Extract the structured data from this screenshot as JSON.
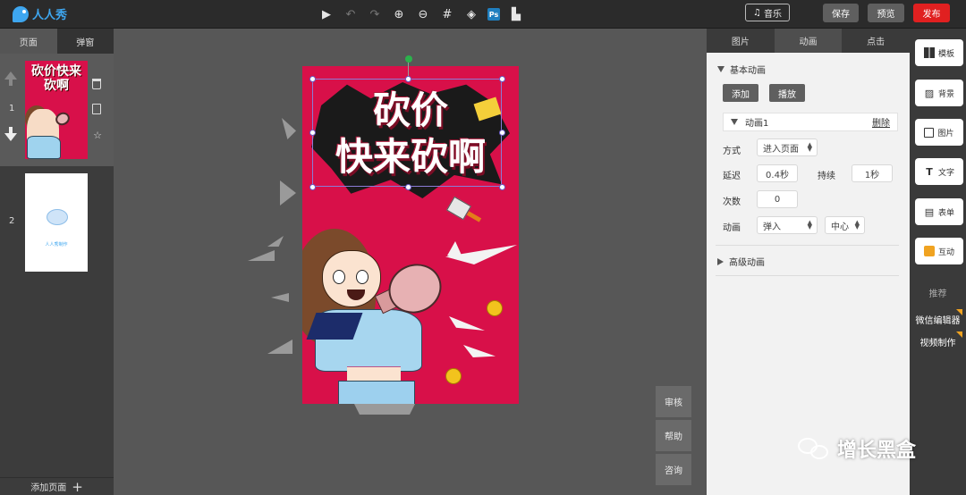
{
  "app": {
    "logo_text": "人人秀",
    "brand_color": "#3ea6ef"
  },
  "toolbar": {
    "icons": [
      "play-icon",
      "undo-icon",
      "redo-icon",
      "zoom-in-icon",
      "zoom-out-icon",
      "grid-icon",
      "layers-icon",
      "ps-icon",
      "align-icon"
    ],
    "ps_label": "Ps",
    "music_label": "音乐",
    "save_label": "保存",
    "preview_label": "预览",
    "publish_label": "发布",
    "publish_color": "#e02020"
  },
  "left_panel": {
    "tabs": [
      {
        "label": "页面"
      },
      {
        "label": "弹窗"
      }
    ],
    "pages": [
      {
        "number": "1",
        "thumb_title": "砍价快来砍啊"
      },
      {
        "number": "2",
        "thumb_caption": "人人秀制作"
      }
    ],
    "add_page_label": "添加页面"
  },
  "canvas": {
    "poster_title_line1": "砍价",
    "poster_title_line2": "快来砍啊",
    "poster_bg_color": "#d81049",
    "side_buttons": [
      {
        "label": "审核"
      },
      {
        "label": "帮助"
      },
      {
        "label": "咨询"
      }
    ]
  },
  "properties": {
    "tabs": [
      {
        "label": "图片"
      },
      {
        "label": "动画"
      },
      {
        "label": "点击"
      }
    ],
    "active_tab": "动画",
    "basic_anim_title": "基本动画",
    "add_label": "添加",
    "play_label": "播放",
    "anim_item_label": "动画1",
    "delete_label": "删除",
    "mode_label": "方式",
    "mode_value": "进入页面",
    "delay_label": "延迟",
    "delay_value": "0.4秒",
    "duration_label": "持续",
    "duration_value": "1秒",
    "count_label": "次数",
    "count_value": "0",
    "anim_label": "动画",
    "anim_value": "弹入",
    "direction_value": "中心",
    "advanced_anim_title": "高级动画"
  },
  "right_toolbar": {
    "buttons": [
      {
        "label": "模板",
        "icon": "template-icon"
      },
      {
        "label": "背景",
        "icon": "background-icon"
      },
      {
        "label": "图片",
        "icon": "image-icon"
      },
      {
        "label": "文字",
        "icon": "text-icon"
      },
      {
        "label": "表单",
        "icon": "form-icon"
      },
      {
        "label": "互动",
        "icon": "interaction-icon"
      }
    ],
    "text_icon_glyph": "T",
    "recommend_label": "推荐",
    "links": [
      {
        "label": "微信编辑器"
      },
      {
        "label": "视频制作"
      }
    ]
  },
  "watermark": {
    "text": "增长黑盒"
  }
}
